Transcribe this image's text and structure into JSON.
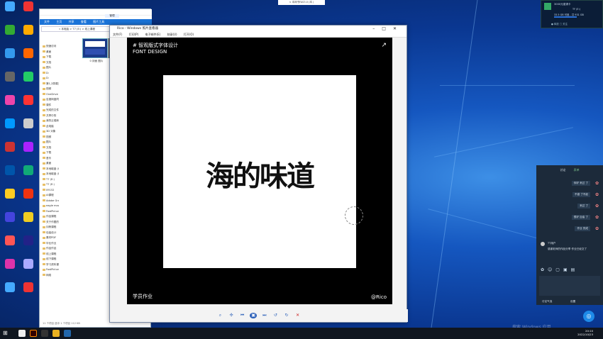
{
  "notification": "< 本网书FAS3.0 (本 )",
  "explorer": {
    "ribbon_tabs": [
      "文件",
      "主页",
      "共享",
      "查看",
      "图片工具"
    ],
    "manage_label": "管理",
    "address": "« 本电脑 > T7 (E:) > 线上课程",
    "nav_items": [
      "快速访问",
      "桌面",
      "下载",
      "文档",
      "图片",
      "D:",
      "D:",
      "第1,2周课文件",
      "视频",
      "OneDrive",
      "百度网盘同步空间",
      "课件",
      "完成的文件",
      "共享中的",
      "我的云端库library",
      "此电脑",
      "3D 对象",
      "视频",
      "图片",
      "文档",
      "下载",
      "音乐",
      "桌面",
      "本地磁盘 (C:)",
      "本地磁盘 (D:)",
      "T7 (E:)",
      "T7 (E:)",
      "09152",
      "AI课程",
      "Adobe Graphics 字",
      "eagle mac",
      "FastPictureViewer",
      "作品课程",
      "关于作图的作业",
      "训练课程",
      "包装设计",
      "素材PDF",
      "毕业作业",
      "作品作品",
      "线上课程",
      "线下课程",
      "学习资料课程",
      "FastPictureViewer",
      "网络"
    ],
    "thumb_caption": "0 封面 图片",
    "status": "11 个项目   选中 1 个项目 112 KB"
  },
  "viewer": {
    "title": "Rico - Windows 照片查看器",
    "menu": [
      "文件(F)",
      "打印(P)",
      "电子邮件(E)",
      "刻录(U)",
      "打开(O)"
    ],
    "image": {
      "top_label": "# 智观版式字体设计",
      "top_sublabel": "FONT DESIGN",
      "logo_text": "海的味道",
      "bottom_left": "学员作业",
      "bottom_right": "@Rico"
    }
  },
  "widget": {
    "title": "3000元邀请卡",
    "lines": [
      "TF (E:)",
      "33.5 GB 可用，共 931 GB",
      "● 释放  □ 关注"
    ]
  },
  "sidepanel": {
    "tabs": [
      "讨论",
      "表单"
    ],
    "messages": [
      "你好 来过 了",
      "不错 了不起",
      "来过 了",
      "很好 加油 了",
      "作业 完成"
    ],
    "user": "TT用户",
    "note": "感谢老师的作品分享 作业已经交了",
    "bottom_left": "讨论气泡",
    "bottom_right": "设置"
  },
  "taskbar": {
    "clock_time": "20:10",
    "clock_date": "2022/10/23",
    "watermark": "搜索 Windows 应用"
  }
}
